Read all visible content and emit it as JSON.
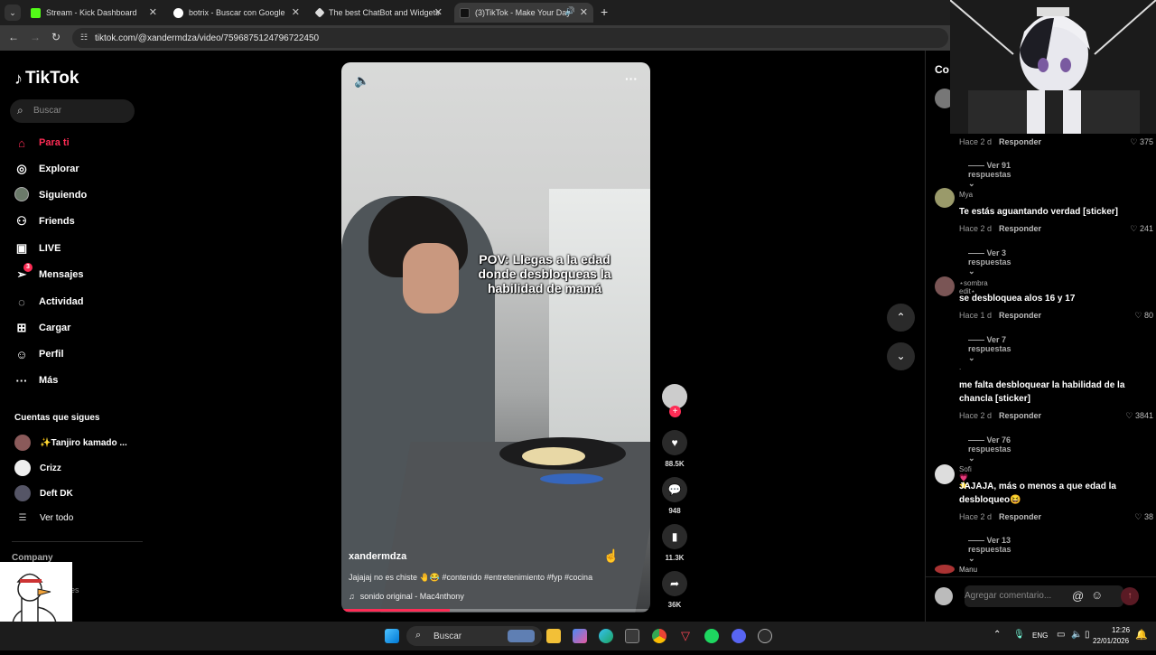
{
  "browser": {
    "tabs": [
      {
        "title": "Stream - Kick Dashboard",
        "color": "#53fc18"
      },
      {
        "title": "botrix - Buscar con Google",
        "color": "#4285f4"
      },
      {
        "title": "The best ChatBot and Widgets",
        "color": "#ffffff"
      },
      {
        "title": "(3)TikTok - Make Your Day",
        "color": "#111111"
      }
    ],
    "url": "tiktok.com/@xandermdza/video/7596875124796722450"
  },
  "sidebar": {
    "brand": "TikTok",
    "search_placeholder": "Buscar",
    "nav": [
      {
        "label": "Para ti",
        "icon": "home-icon"
      },
      {
        "label": "Explorar",
        "icon": "compass-icon"
      },
      {
        "label": "Siguiendo",
        "icon": "following-avatar-icon"
      },
      {
        "label": "Friends",
        "icon": "friends-icon"
      },
      {
        "label": "LIVE",
        "icon": "live-icon"
      },
      {
        "label": "Mensajes",
        "icon": "messages-icon",
        "badge": "3"
      },
      {
        "label": "Actividad",
        "icon": "activity-icon"
      },
      {
        "label": "Cargar",
        "icon": "upload-icon"
      },
      {
        "label": "Perfil",
        "icon": "profile-icon"
      },
      {
        "label": "Más",
        "icon": "more-icon"
      }
    ],
    "following_header": "Cuentas que sigues",
    "following": [
      {
        "name": "✨Tanjiro kamado ..."
      },
      {
        "name": "Crizz"
      },
      {
        "name": "Deft DK"
      }
    ],
    "see_all": "Ver todo",
    "company": "Company",
    "company_partial": "es"
  },
  "video": {
    "overlay_text": "POV: Llegas a la edad donde desbloqueas la habilidad de mamá",
    "username": "xandermdza",
    "description": "Jajajaj no es chiste 🤚😂 #contenido #entretenimiento #fyp #cocina",
    "sound": "sonido original - Mac4nthony",
    "progress": 0.35
  },
  "actions": {
    "likes": "88.5K",
    "comments": "948",
    "saves": "11.3K",
    "shares": "36K"
  },
  "comments": {
    "header": "Co",
    "items": [
      {
        "name": "",
        "text": "",
        "time": "Hace 2 d",
        "reply": "Responder",
        "likes": "375",
        "replies": "Ver 91 respuestas"
      },
      {
        "name": "Mya",
        "text": "Te estás aguantando verdad [sticker]",
        "time": "Hace 2 d",
        "reply": "Responder",
        "likes": "241",
        "replies": "Ver 3 respuestas"
      },
      {
        "name": "⋆sombra edit⋆",
        "text": "se desbloquea alos 16 y 17",
        "time": "Hace 1 d",
        "reply": "Responder",
        "likes": "80",
        "replies": "Ver 7 respuestas"
      },
      {
        "name": ".",
        "text": "me falta desbloquear la habilidad de la chancla [sticker]",
        "time": "Hace 2 d",
        "reply": "Responder",
        "likes": "3841",
        "replies": "Ver 76 respuestas"
      },
      {
        "name": "Sofi💗⭐",
        "text": "JAJAJA, más o menos a que edad la desbloqueo😆",
        "time": "Hace 2 d",
        "reply": "Responder",
        "likes": "38",
        "replies": "Ver 13 respuestas"
      },
      {
        "name": "Manu",
        "text": "",
        "time": "",
        "reply": "",
        "likes": "",
        "replies": ""
      }
    ],
    "input_placeholder": "Agregar comentario..."
  },
  "taskbar": {
    "search": "Buscar",
    "lang": "ENG",
    "time": "12:26",
    "date": "22/01/2026"
  }
}
